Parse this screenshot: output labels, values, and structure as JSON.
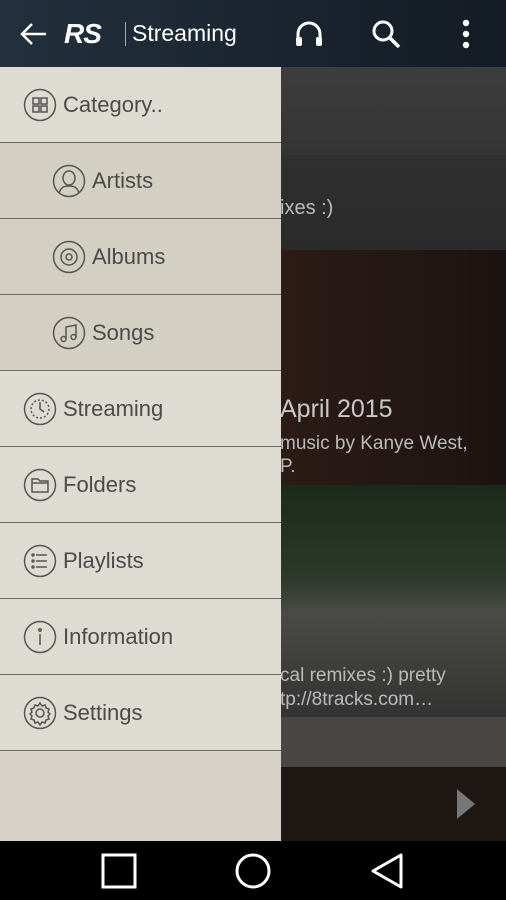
{
  "appbar": {
    "logo": "RS",
    "title": "Streaming",
    "icons": [
      "back-arrow-icon",
      "headphones-icon",
      "search-icon",
      "more-vert-icon"
    ]
  },
  "drawer": {
    "items": [
      {
        "label": "Category..",
        "icon": "grid-icon",
        "sub": false
      },
      {
        "label": "Artists",
        "icon": "person-icon",
        "sub": true
      },
      {
        "label": "Albums",
        "icon": "disc-icon",
        "sub": true
      },
      {
        "label": "Songs",
        "icon": "music-note-icon",
        "sub": true
      },
      {
        "label": "Streaming",
        "icon": "streaming-icon",
        "sub": false
      },
      {
        "label": "Folders",
        "icon": "folder-icon",
        "sub": false
      },
      {
        "label": "Playlists",
        "icon": "list-icon",
        "sub": false
      },
      {
        "label": "Information",
        "icon": "info-icon",
        "sub": false
      },
      {
        "label": "Settings",
        "icon": "gear-icon",
        "sub": false
      }
    ]
  },
  "content": {
    "card1_desc": "ixes :)",
    "card2_title": "April 2015",
    "card2_desc1": "music by Kanye West,",
    "card2_desc2": "P.",
    "card3_desc1": "cal remixes :) pretty",
    "card3_desc2": "tp://8tracks.com…"
  },
  "navbar": {
    "icons": [
      "recents-icon",
      "home-icon",
      "back-icon"
    ]
  }
}
